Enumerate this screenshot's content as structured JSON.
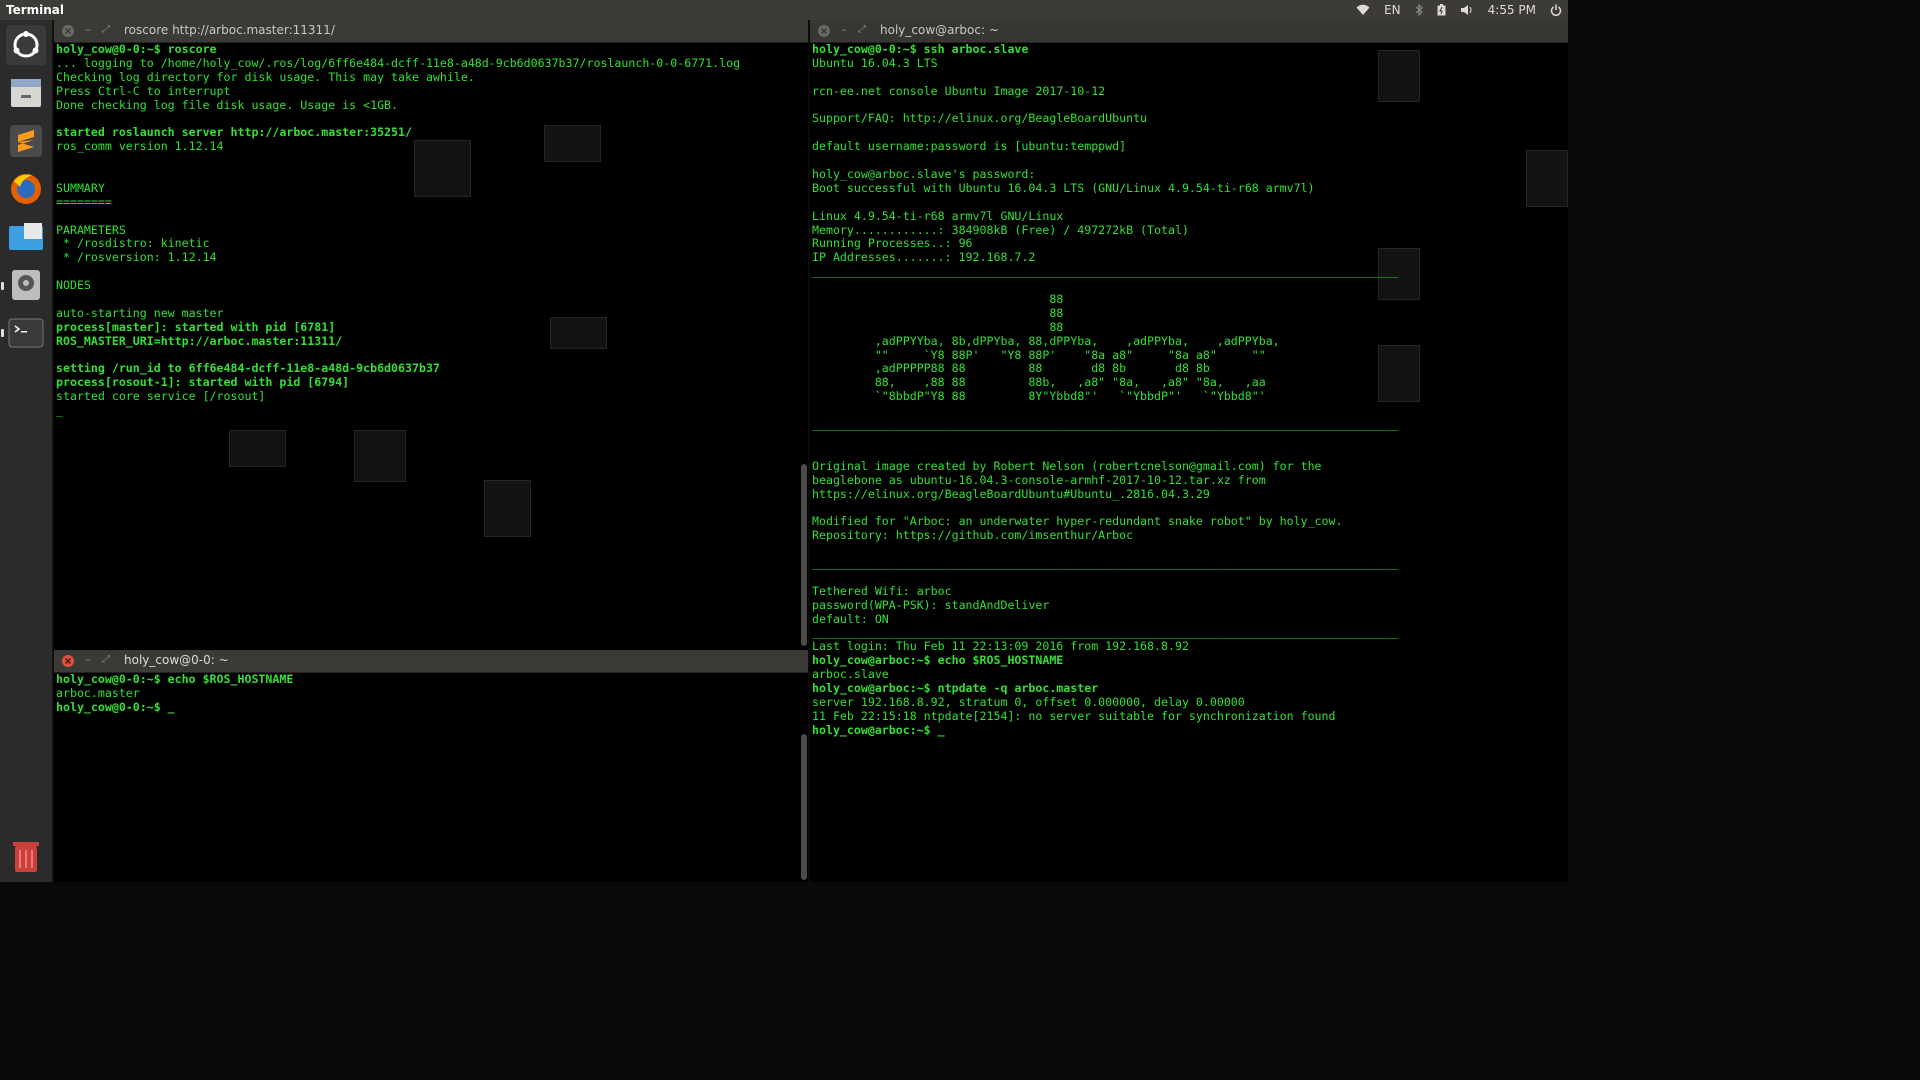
{
  "top_panel": {
    "app_title": "Terminal",
    "language": "EN",
    "time": "4:55 PM"
  },
  "launcher": {
    "items": [
      {
        "name": "ubuntu-dash-icon"
      },
      {
        "name": "files-icon"
      },
      {
        "name": "sublime-text-icon"
      },
      {
        "name": "firefox-icon"
      },
      {
        "name": "folder-icon"
      },
      {
        "name": "disk-utility-icon"
      },
      {
        "name": "terminal-icon"
      },
      {
        "name": "trash-icon"
      }
    ]
  },
  "left_top_terminal": {
    "title": "roscore http://arboc.master:11311/",
    "lines": [
      {
        "t": "holy_cow@0-0:~$ roscore",
        "b": true
      },
      {
        "t": "... logging to /home/holy_cow/.ros/log/6ff6e484-dcff-11e8-a48d-9cb6d0637b37/roslaunch-0-0-6771.log",
        "b": false
      },
      {
        "t": "Checking log directory for disk usage. This may take awhile.",
        "b": false
      },
      {
        "t": "Press Ctrl-C to interrupt",
        "b": false
      },
      {
        "t": "Done checking log file disk usage. Usage is <1GB.",
        "b": false
      },
      {
        "t": "",
        "b": false
      },
      {
        "t": "started roslaunch server http://arboc.master:35251/",
        "b": true
      },
      {
        "t": "ros_comm version 1.12.14",
        "b": false
      },
      {
        "t": "",
        "b": false
      },
      {
        "t": "",
        "b": false
      },
      {
        "t": "SUMMARY",
        "b": false
      },
      {
        "t": "========",
        "b": false
      },
      {
        "t": "",
        "b": false
      },
      {
        "t": "PARAMETERS",
        "b": false
      },
      {
        "t": " * /rosdistro: kinetic",
        "b": false
      },
      {
        "t": " * /rosversion: 1.12.14",
        "b": false
      },
      {
        "t": "",
        "b": false
      },
      {
        "t": "NODES",
        "b": false
      },
      {
        "t": "",
        "b": false
      },
      {
        "t": "auto-starting new master",
        "b": false
      },
      {
        "t": "process[master]: started with pid [6781]",
        "b": true
      },
      {
        "t": "ROS_MASTER_URI=http://arboc.master:11311/",
        "b": true
      },
      {
        "t": "",
        "b": false
      },
      {
        "t": "setting /run_id to 6ff6e484-dcff-11e8-a48d-9cb6d0637b37",
        "b": true
      },
      {
        "t": "process[rosout-1]: started with pid [6794]",
        "b": true
      },
      {
        "t": "started core service [/rosout]",
        "b": false
      },
      {
        "t": "_",
        "b": false
      }
    ]
  },
  "left_bottom_terminal": {
    "title": "holy_cow@0-0: ~",
    "lines": [
      {
        "t": "holy_cow@0-0:~$ echo $ROS_HOSTNAME",
        "b": true
      },
      {
        "t": "arboc.master",
        "b": false
      },
      {
        "t": "holy_cow@0-0:~$ _",
        "b": true
      }
    ]
  },
  "right_terminal": {
    "title": "holy_cow@arboc: ~",
    "lines": [
      {
        "t": "holy_cow@0-0:~$ ssh arboc.slave",
        "b": true
      },
      {
        "t": "Ubuntu 16.04.3 LTS",
        "b": false
      },
      {
        "t": "",
        "b": false
      },
      {
        "t": "rcn-ee.net console Ubuntu Image 2017-10-12",
        "b": false
      },
      {
        "t": "",
        "b": false
      },
      {
        "t": "Support/FAQ: http://elinux.org/BeagleBoardUbuntu",
        "b": false
      },
      {
        "t": "",
        "b": false
      },
      {
        "t": "default username:password is [ubuntu:temppwd]",
        "b": false
      },
      {
        "t": "",
        "b": false
      },
      {
        "t": "holy_cow@arboc.slave's password:",
        "b": false
      },
      {
        "t": "Boot successful with Ubuntu 16.04.3 LTS (GNU/Linux 4.9.54-ti-r68 armv7l)",
        "b": false
      },
      {
        "t": "",
        "b": false
      },
      {
        "t": "Linux 4.9.54-ti-r68 armv7l GNU/Linux",
        "b": false
      },
      {
        "t": "Memory............: 384908kB (Free) / 497272kB (Total)",
        "b": false
      },
      {
        "t": "Running Processes..: 96",
        "b": false
      },
      {
        "t": "IP Addresses.......: 192.168.7.2",
        "b": false
      },
      {
        "t": "____________________________________________________________________________________",
        "b": false
      },
      {
        "t": "",
        "b": false
      },
      {
        "t": "                                  88",
        "b": false
      },
      {
        "t": "                                  88",
        "b": false
      },
      {
        "t": "                                  88",
        "b": false
      },
      {
        "t": "         ,adPPYYba, 8b,dPPYba, 88,dPPYba,    ,adPPYba,    ,adPPYba,",
        "b": false
      },
      {
        "t": "         \"\"     `Y8 88P'   \"Y8 88P'    \"8a a8\"     \"8a a8\"     \"\"",
        "b": false
      },
      {
        "t": "         ,adPPPPP88 88         88       d8 8b       d8 8b",
        "b": false
      },
      {
        "t": "         88,    ,88 88         88b,   ,a8\" \"8a,   ,a8\" \"8a,   ,aa",
        "b": false
      },
      {
        "t": "         `\"8bbdP\"Y8 88         8Y\"Ybbd8\"'   `\"YbbdP\"'   `\"Ybbd8\"'",
        "b": false
      },
      {
        "t": "",
        "b": false
      },
      {
        "t": "____________________________________________________________________________________",
        "b": false
      },
      {
        "t": "",
        "b": false
      },
      {
        "t": "",
        "b": false
      },
      {
        "t": "Original image created by Robert Nelson (robertcnelson@gmail.com) for the",
        "b": false
      },
      {
        "t": "beaglebone as ubuntu-16.04.3-console-armhf-2017-10-12.tar.xz from",
        "b": false
      },
      {
        "t": "https://elinux.org/BeagleBoardUbuntu#Ubuntu_.2816.04.3.29",
        "b": false
      },
      {
        "t": "",
        "b": false
      },
      {
        "t": "Modified for \"Arboc: an underwater hyper-redundant snake robot\" by holy_cow.",
        "b": false
      },
      {
        "t": "Repository: https://github.com/imsenthur/Arboc",
        "b": false
      },
      {
        "t": "",
        "b": false
      },
      {
        "t": "____________________________________________________________________________________",
        "b": false
      },
      {
        "t": "",
        "b": false
      },
      {
        "t": "Tethered Wifi: arboc",
        "b": false
      },
      {
        "t": "password(WPA-PSK): standAndDeliver",
        "b": false
      },
      {
        "t": "default: ON",
        "b": false
      },
      {
        "t": "____________________________________________________________________________________",
        "b": false
      },
      {
        "t": "Last login: Thu Feb 11 22:13:09 2016 from 192.168.8.92",
        "b": false
      },
      {
        "t": "holy_cow@arboc:~$ echo $ROS_HOSTNAME",
        "b": true
      },
      {
        "t": "arboc.slave",
        "b": false
      },
      {
        "t": "holy_cow@arboc:~$ ntpdate -q arboc.master",
        "b": true
      },
      {
        "t": "server 192.168.8.92, stratum 0, offset 0.000000, delay 0.00000",
        "b": false
      },
      {
        "t": "11 Feb 22:15:18 ntpdate[2154]: no server suitable for synchronization found",
        "b": false
      },
      {
        "t": "holy_cow@arboc:~$ _",
        "b": true
      }
    ]
  },
  "colors": {
    "terminal_text": "#33e033",
    "terminal_bg": "#000000",
    "close_button": "#e0503c",
    "panel_bg": "#3c3b37",
    "launcher_bg": "#2b2b2b"
  }
}
